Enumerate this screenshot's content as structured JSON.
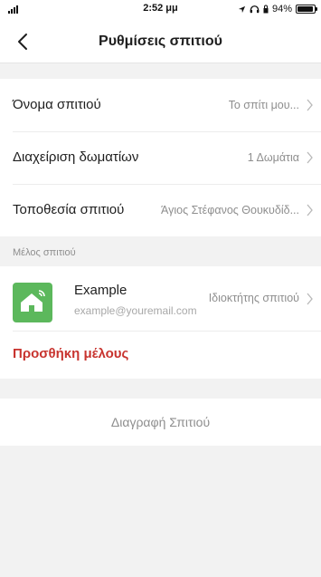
{
  "status_bar": {
    "time": "2:52 μμ",
    "battery": "94%",
    "battery_level": 0.94
  },
  "nav": {
    "title": "Ρυθμίσεις σπιτιού"
  },
  "settings": [
    {
      "label": "Όνομα σπιτιού",
      "value": "Το σπίτι μου..."
    },
    {
      "label": "Διαχείριση δωματίων",
      "value": "1 Δωμάτια"
    },
    {
      "label": "Τοποθεσία σπιτιού",
      "value": "Άγιος Στέφανος Θουκυδίδ..."
    }
  ],
  "members": {
    "section_label": "Μέλος σπιτιού",
    "list": [
      {
        "name": "Example",
        "email": "example@youremail.com",
        "role": "Ιδιοκτήτης σπιτιού"
      }
    ],
    "add_label": "Προσθήκη μέλους"
  },
  "delete_label": "Διαγραφή Σπιτιού",
  "colors": {
    "accent_red": "#c8342f",
    "avatar_green": "#5cb85c",
    "background": "#f2f2f2"
  }
}
